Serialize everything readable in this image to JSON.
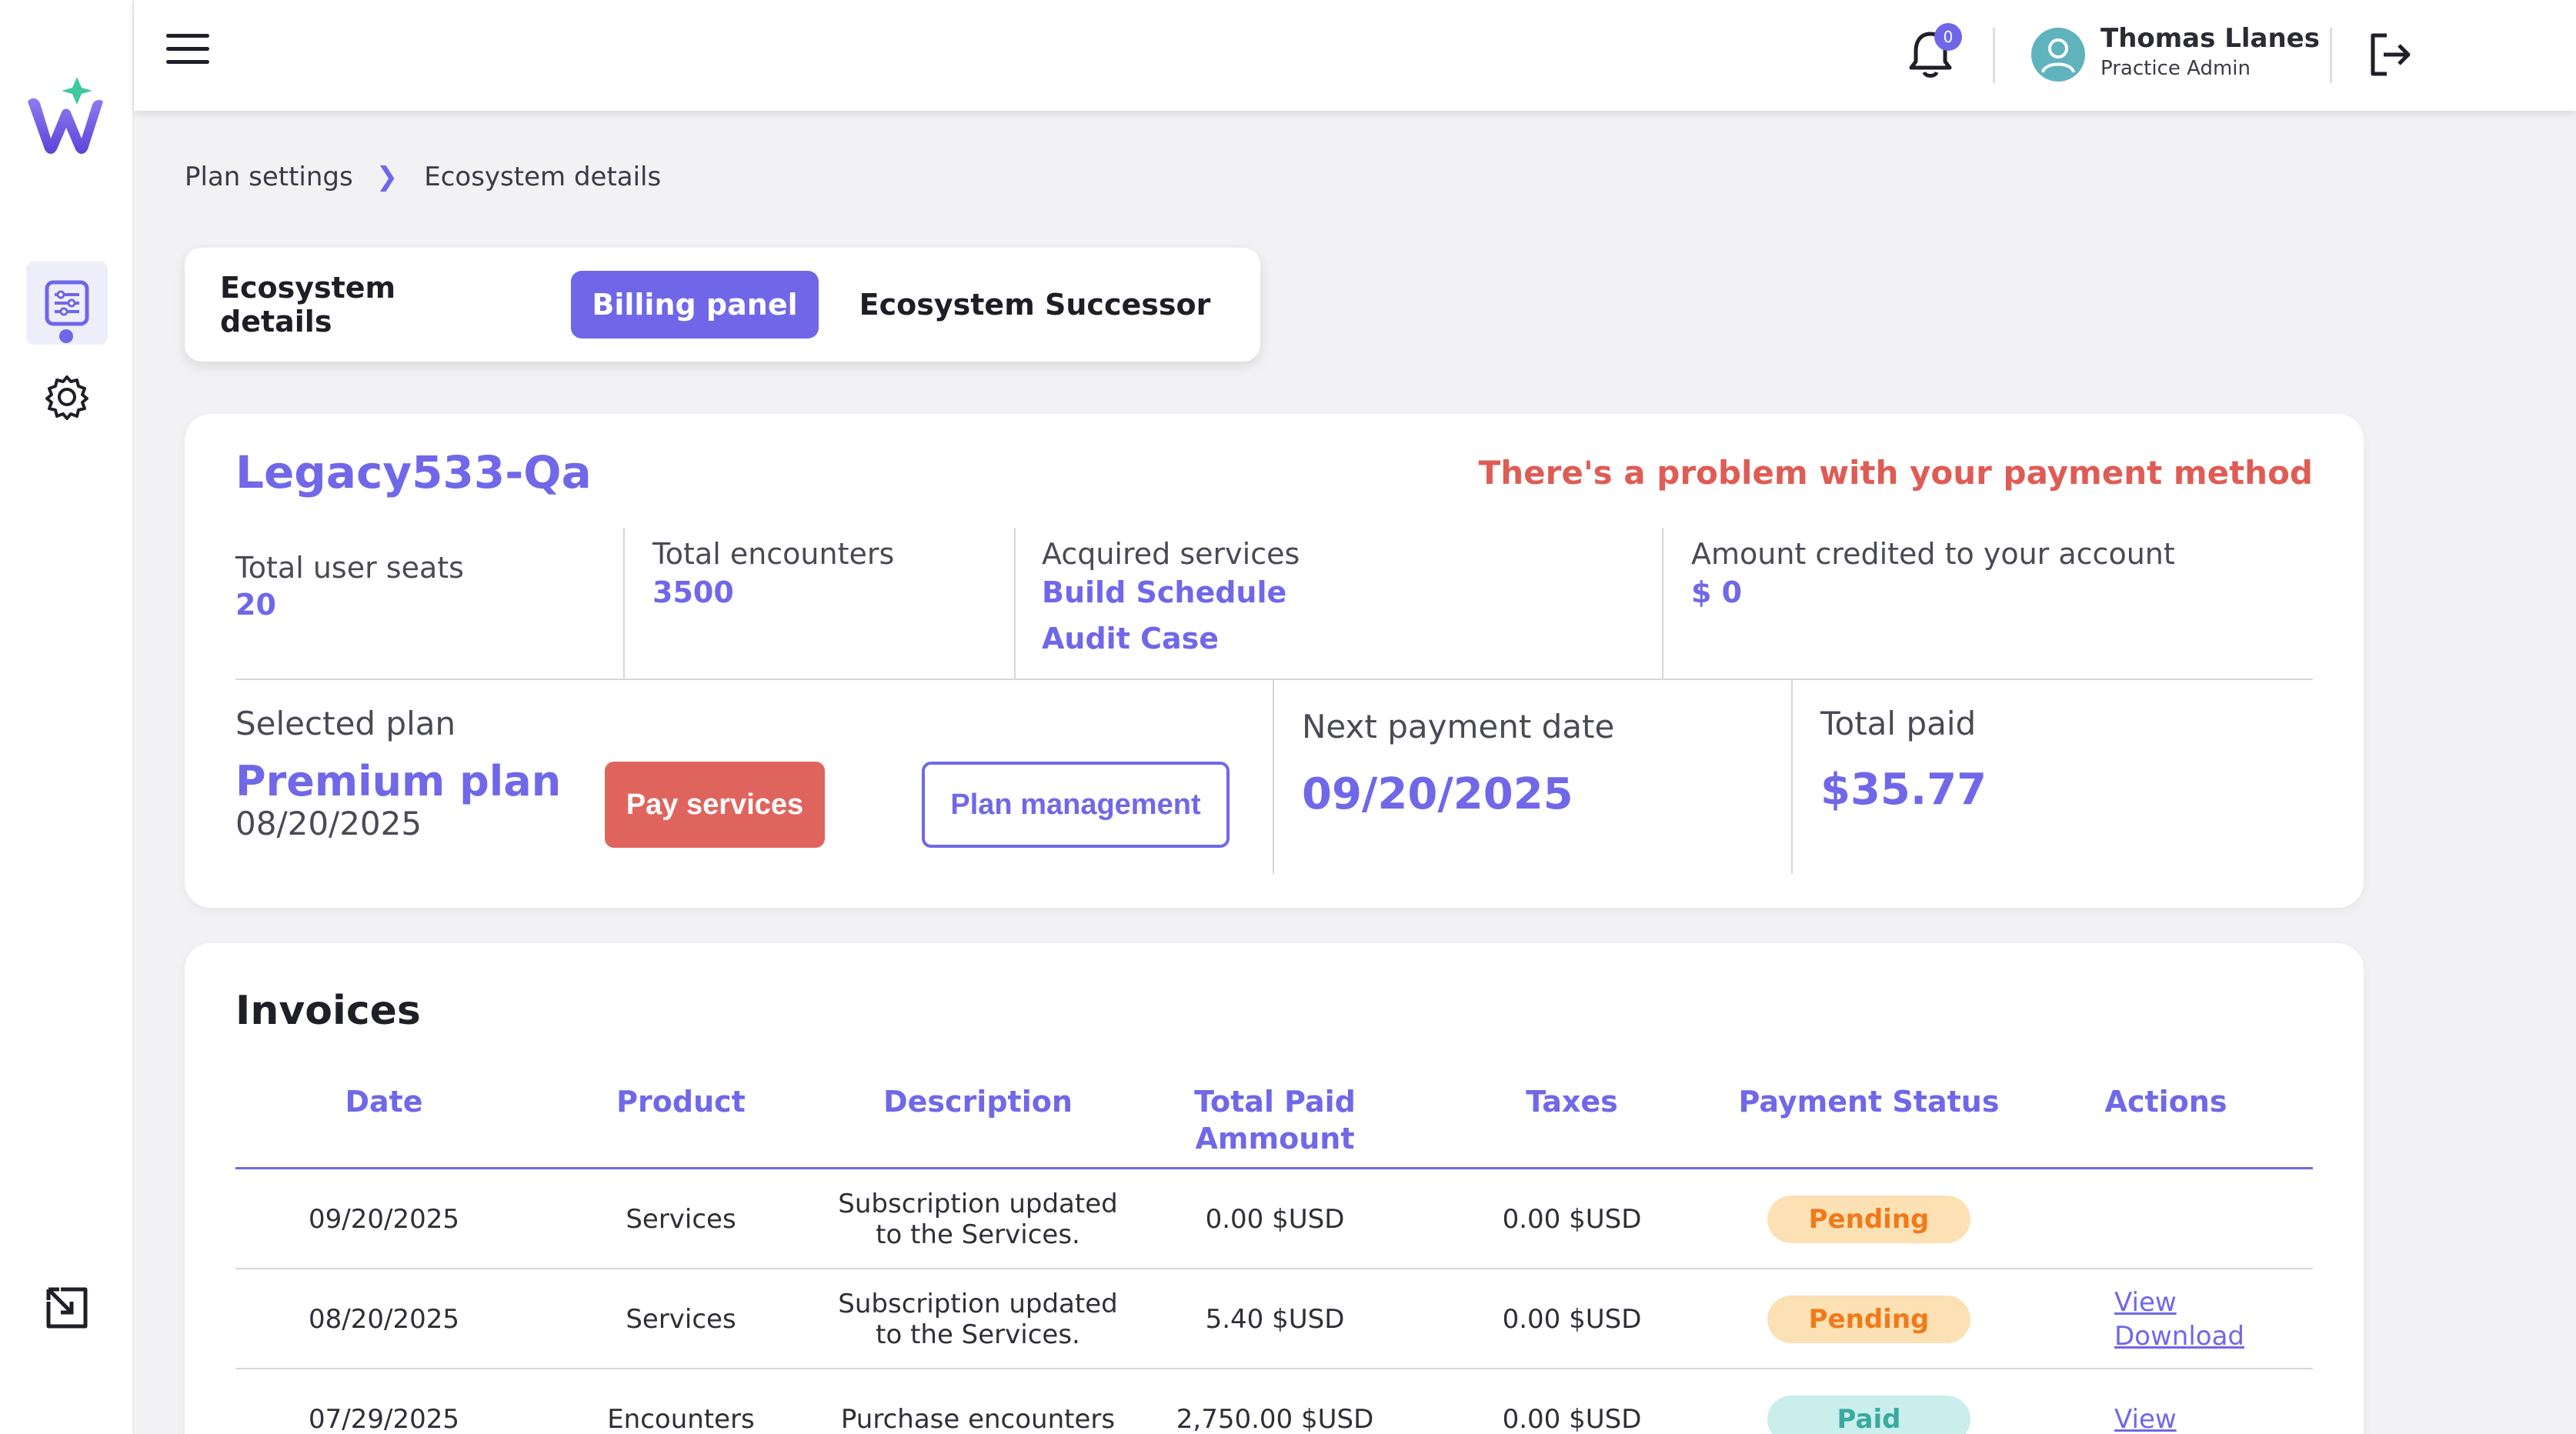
{
  "header": {
    "notification_count": "0",
    "user_name": "Thomas Llanes",
    "user_role": "Practice Admin"
  },
  "breadcrumb": {
    "parent": "Plan settings",
    "current": "Ecosystem details"
  },
  "tabs": [
    {
      "label": "Ecosystem details",
      "active": false
    },
    {
      "label": "Billing panel",
      "active": true
    },
    {
      "label": "Ecosystem Successor",
      "active": false
    }
  ],
  "summary": {
    "ecosystem_name": "Legacy533-Qa",
    "payment_warning": "There's a problem with your payment method",
    "total_user_seats_label": "Total user seats",
    "total_user_seats": "20",
    "total_encounters_label": "Total encounters",
    "total_encounters": "3500",
    "acquired_services_label": "Acquired services",
    "acquired_services": [
      "Build Schedule",
      "Audit Case"
    ],
    "amount_credited_label": "Amount credited to your account",
    "amount_credited": "$ 0",
    "selected_plan_label": "Selected plan",
    "plan_name": "Premium plan",
    "plan_date": "08/20/2025",
    "pay_services_label": "Pay services",
    "plan_management_label": "Plan management",
    "next_payment_label": "Next payment date",
    "next_payment_date": "09/20/2025",
    "total_paid_label": "Total paid",
    "total_paid": "$35.77"
  },
  "invoices": {
    "title": "Invoices",
    "columns": [
      "Date",
      "Product",
      "Description",
      "Total Paid\nAmmount",
      "Taxes",
      "Payment Status",
      "Actions"
    ],
    "rows": [
      {
        "date": "09/20/2025",
        "product": "Services",
        "description": "Subscription updated\nto the Services.",
        "total": "0.00 $USD",
        "taxes": "0.00 $USD",
        "status": "Pending",
        "actions": []
      },
      {
        "date": "08/20/2025",
        "product": "Services",
        "description": "Subscription updated\nto the Services.",
        "total": "5.40 $USD",
        "taxes": "0.00 $USD",
        "status": "Pending",
        "actions": [
          "View",
          "Download"
        ]
      },
      {
        "date": "07/29/2025",
        "product": "Encounters",
        "description": "Purchase encounters",
        "total": "2,750.00 $USD",
        "taxes": "0.00 $USD",
        "status": "Paid",
        "actions": [
          "View"
        ]
      }
    ]
  },
  "colors": {
    "accent": "#6f67e8",
    "warning": "#df5c55",
    "pending_bg": "#fbe1b4",
    "pending_text": "#f07a1a",
    "paid_bg": "#c9eeec",
    "paid_text": "#3aa9a0"
  },
  "icons": {
    "sidebar": [
      "app-logo",
      "dashboard-list-icon",
      "gear-icon",
      "expand-window-icon"
    ],
    "header": [
      "hamburger-menu-icon",
      "bell-icon",
      "user-avatar-icon",
      "logout-icon"
    ]
  }
}
